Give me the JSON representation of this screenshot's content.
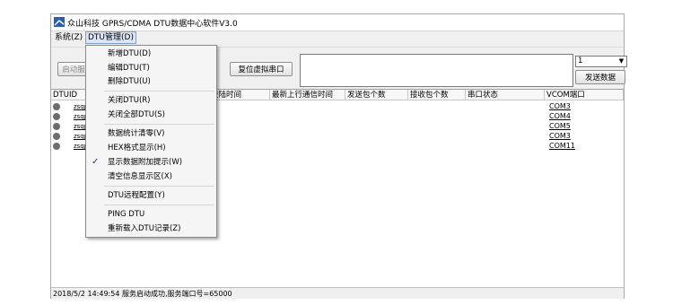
{
  "window": {
    "title": "众山科技 GPRS/CDMA DTU数据中心软件V3.0"
  },
  "menu": {
    "items": [
      "系统(Z)",
      "DTU管理(D)"
    ]
  },
  "toolbar": {
    "start_label": "启动服",
    "reset_label": "复位虚拟串口",
    "combo_value": "1",
    "send_label": "发送数据"
  },
  "grid": {
    "columns": [
      "DTUID",
      "登陆时间",
      "最新上行通信时间",
      "发送包个数",
      "接收包个数",
      "串口状态",
      "VCOM端口"
    ],
    "rows": [
      {
        "id": "zsqp",
        "vcom": "COM3"
      },
      {
        "id": "zsqp",
        "vcom": "COM4"
      },
      {
        "id": "zsqp",
        "vcom": "COM5"
      },
      {
        "id": "zsqp",
        "vcom": "COM3"
      },
      {
        "id": "zsqp",
        "vcom": "COM11"
      }
    ]
  },
  "dropdown": {
    "items": [
      {
        "label": "新增DTU(D)",
        "checked": false
      },
      {
        "label": "编辑DTU(T)",
        "checked": false
      },
      {
        "label": "删除DTU(U)",
        "checked": false
      },
      {
        "label": "关闭DTU(R)",
        "checked": false
      },
      {
        "label": "关闭全部DTU(S)",
        "checked": false
      },
      {
        "label": "数据统计清零(V)",
        "checked": false
      },
      {
        "label": "HEX格式显示(H)",
        "checked": false
      },
      {
        "label": "显示数据附加提示(W)",
        "checked": true
      },
      {
        "label": "清空信息显示区(X)",
        "checked": false
      },
      {
        "label": "DTU远程配置(Y)",
        "checked": false
      },
      {
        "label": "PING DTU",
        "checked": false
      },
      {
        "label": "重新载入DTU记录(Z)",
        "checked": false
      }
    ]
  },
  "status": {
    "text": "2018/5/2 14:49:54 服务启动成功,服务端口号=65000"
  },
  "colors": {
    "accent": "#1f3f8a",
    "menu_highlight": "#dbe7f7"
  }
}
